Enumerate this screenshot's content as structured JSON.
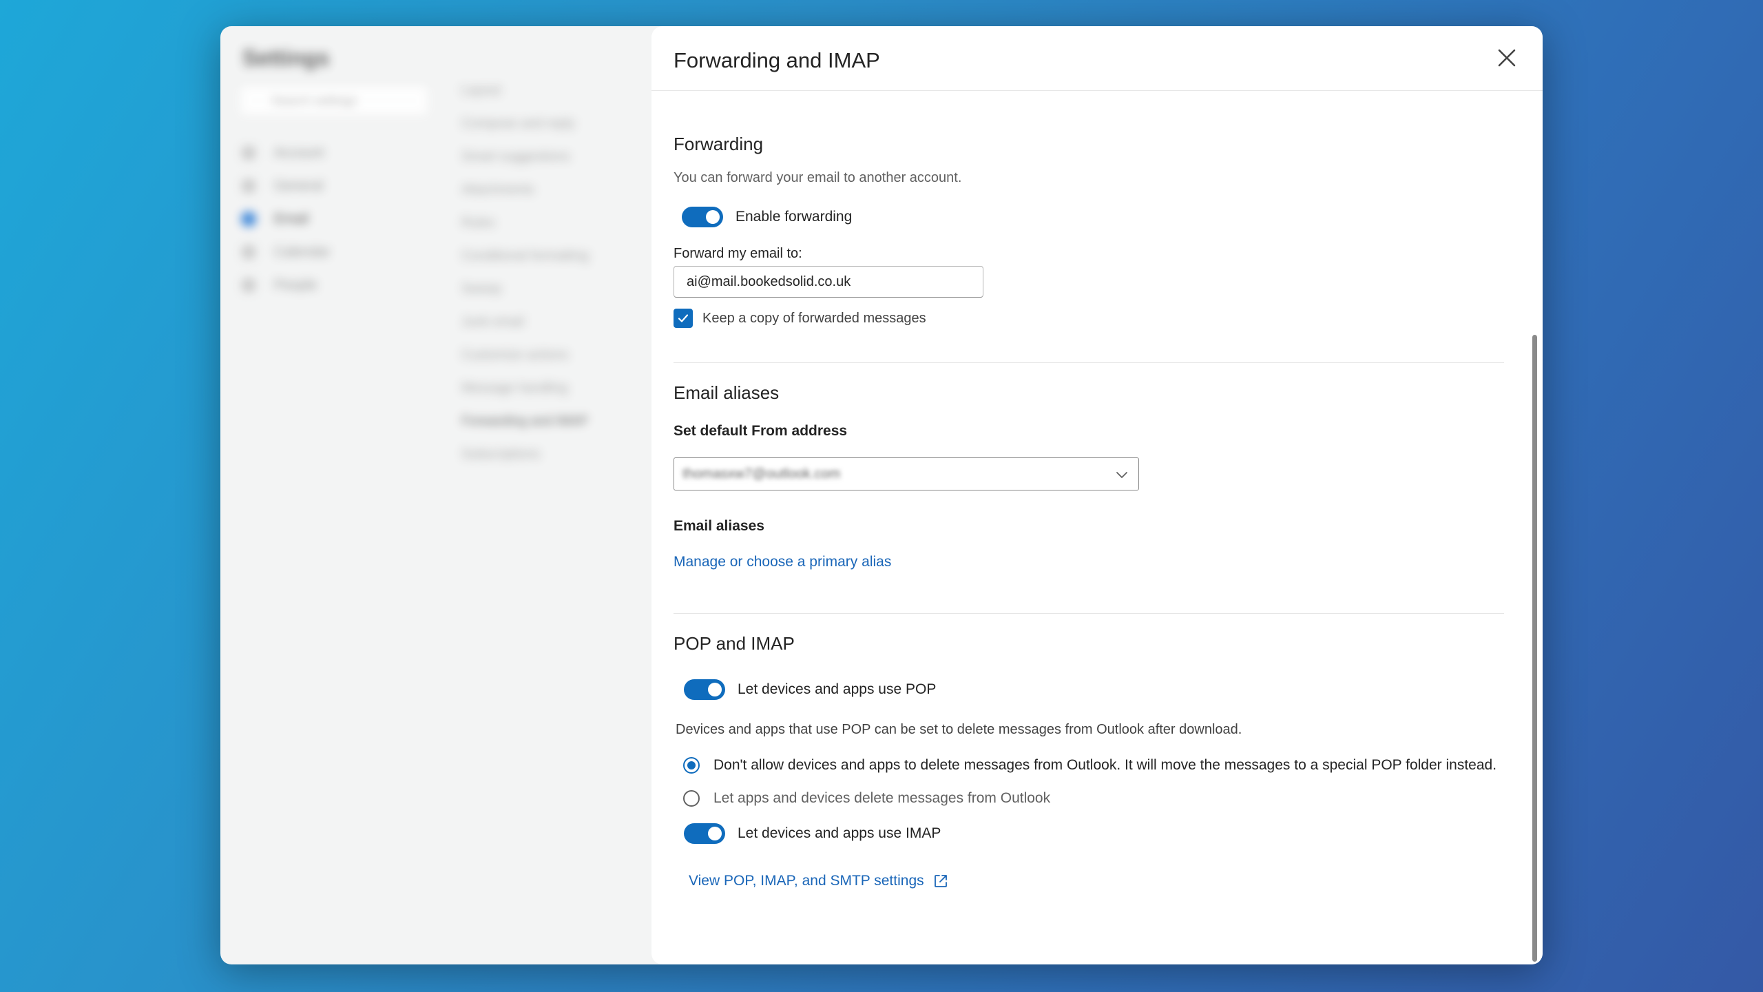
{
  "background_settings": {
    "title": "Settings",
    "search_placeholder": "Search settings",
    "nav": [
      "Account",
      "General",
      "Email",
      "Calendar",
      "People"
    ],
    "active_nav": "Email",
    "subnav": [
      "Layout",
      "Compose and reply",
      "Smart suggestions",
      "Attachments",
      "Rules",
      "Conditional formatting",
      "Sweep",
      "Junk email",
      "Customize actions",
      "Message handling",
      "Forwarding and IMAP",
      "Subscriptions"
    ],
    "active_subnav": "Forwarding and IMAP"
  },
  "panel": {
    "title": "Forwarding and IMAP",
    "close_icon": "close-icon"
  },
  "forwarding": {
    "title": "Forwarding",
    "description": "You can forward your email to another account.",
    "enable_label": "Enable forwarding",
    "enabled": true,
    "forward_to_label": "Forward my email to:",
    "forward_to_value": "ai@mail.bookedsolid.co.uk",
    "keep_copy_label": "Keep a copy of forwarded messages",
    "keep_copy_checked": true
  },
  "aliases": {
    "title": "Email aliases",
    "default_from_label": "Set default From address",
    "default_from_value": "thomasxw7@outlook.com",
    "aliases_label": "Email aliases",
    "manage_link": "Manage or choose a primary alias"
  },
  "pop_imap": {
    "title": "POP and IMAP",
    "pop_label": "Let devices and apps use POP",
    "pop_enabled": true,
    "pop_description": "Devices and apps that use POP can be set to delete messages from Outlook after download.",
    "option_no_delete": "Don't allow devices and apps to delete messages from Outlook. It will move the messages to a special POP folder instead.",
    "option_delete": "Let apps and devices delete messages from Outlook",
    "selected_option": "no_delete",
    "imap_label": "Let devices and apps use IMAP",
    "imap_enabled": true,
    "settings_link": "View POP, IMAP, and SMTP settings",
    "external_icon": "external-link-icon"
  },
  "colors": {
    "accent": "#0f6cbd",
    "link": "#1a66b8"
  }
}
